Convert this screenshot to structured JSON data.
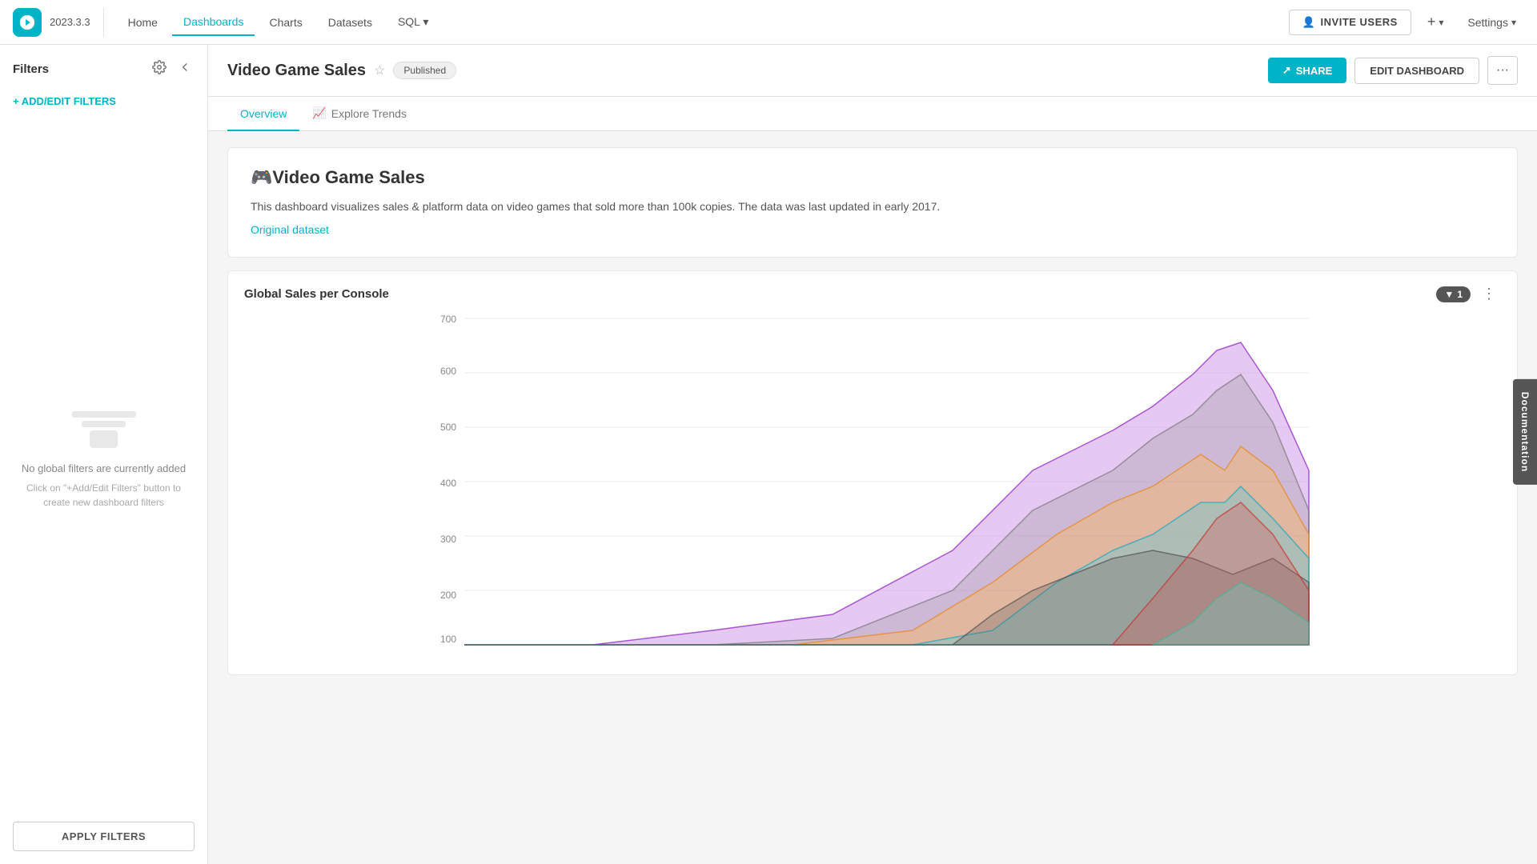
{
  "app": {
    "version": "2023.3.3",
    "logo_label": "Preset Logo"
  },
  "nav": {
    "items": [
      {
        "label": "Home",
        "active": false
      },
      {
        "label": "Dashboards",
        "active": true
      },
      {
        "label": "Charts",
        "active": false
      },
      {
        "label": "Datasets",
        "active": false
      },
      {
        "label": "SQL",
        "active": false
      }
    ],
    "invite_users_label": "INVITE USERS",
    "add_label": "+",
    "settings_label": "Settings"
  },
  "sidebar": {
    "title": "Filters",
    "add_filter_label": "+ ADD/EDIT FILTERS",
    "empty_text": "No global filters are currently added",
    "empty_hint": "Click on \"+Add/Edit Filters\" button to create new dashboard filters",
    "apply_label": "APPLY FILTERS"
  },
  "dashboard": {
    "title": "Video Game Sales",
    "status": "Published",
    "share_label": "SHARE",
    "edit_label": "EDIT DASHBOARD",
    "tabs": [
      {
        "label": "Overview",
        "active": true,
        "icon": ""
      },
      {
        "label": "Explore Trends",
        "active": false,
        "icon": "📈"
      }
    ],
    "info": {
      "title": "🎮Video Game Sales",
      "description": "This dashboard visualizes sales & platform data on video games that sold more than 100k copies. The data was last updated in early 2017.",
      "link_label": "Original dataset",
      "link_href": "#"
    },
    "chart": {
      "title": "Global Sales per Console",
      "filter_count": "1",
      "y_labels": [
        "700",
        "600",
        "500",
        "400",
        "300",
        "200",
        "100"
      ],
      "y_values": [
        700,
        600,
        500,
        400,
        300,
        200,
        100
      ]
    }
  },
  "documentation": {
    "label": "Documentation"
  }
}
